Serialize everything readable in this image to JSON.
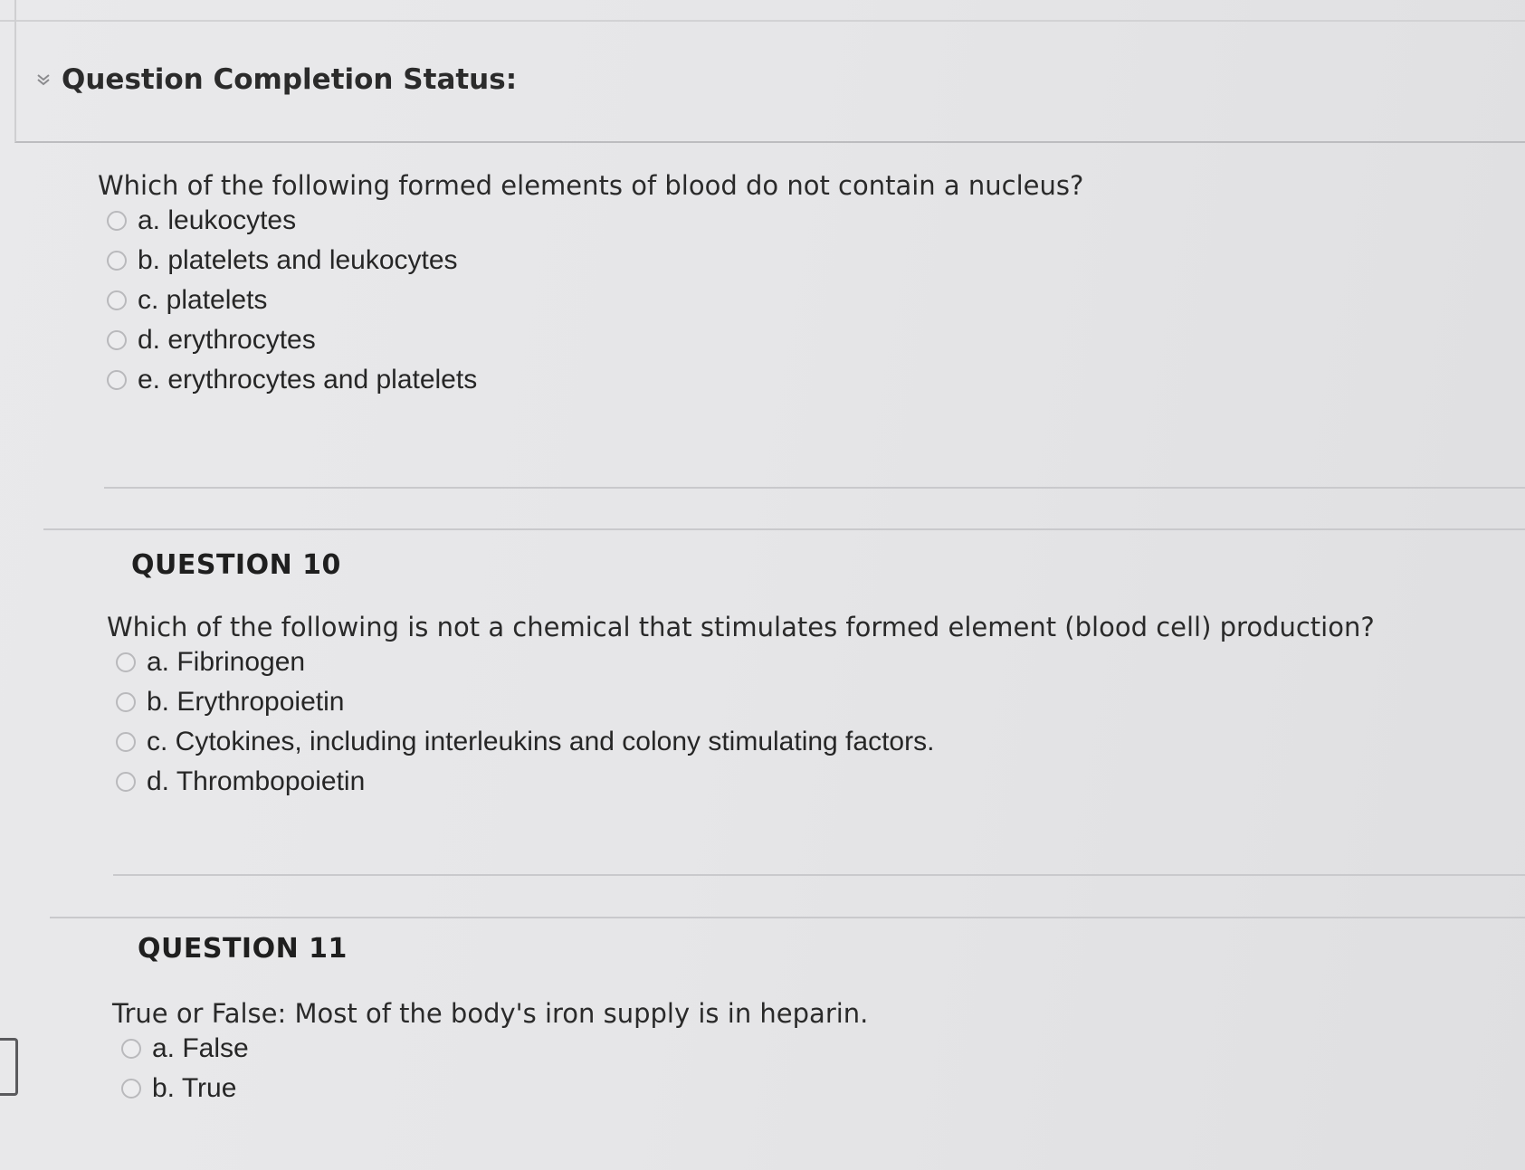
{
  "status": {
    "title": "Question Completion Status:"
  },
  "questions": [
    {
      "heading": "",
      "text": "Which of the following formed elements of blood do not contain a nucleus?",
      "answers": [
        "a. leukocytes",
        "b. platelets and leukocytes",
        "c. platelets",
        "d. erythrocytes",
        "e. erythrocytes and platelets"
      ]
    },
    {
      "heading": "QUESTION 10",
      "text": "Which of the following is not a chemical that stimulates formed element (blood cell) production?",
      "answers": [
        "a. Fibrinogen",
        "b. Erythropoietin",
        "c. Cytokines, including interleukins and colony stimulating factors.",
        "d. Thrombopoietin"
      ]
    },
    {
      "heading": "QUESTION 11",
      "text": "True or False: Most of the body's iron supply is in heparin.",
      "answers": [
        "a. False",
        "b. True"
      ]
    }
  ]
}
